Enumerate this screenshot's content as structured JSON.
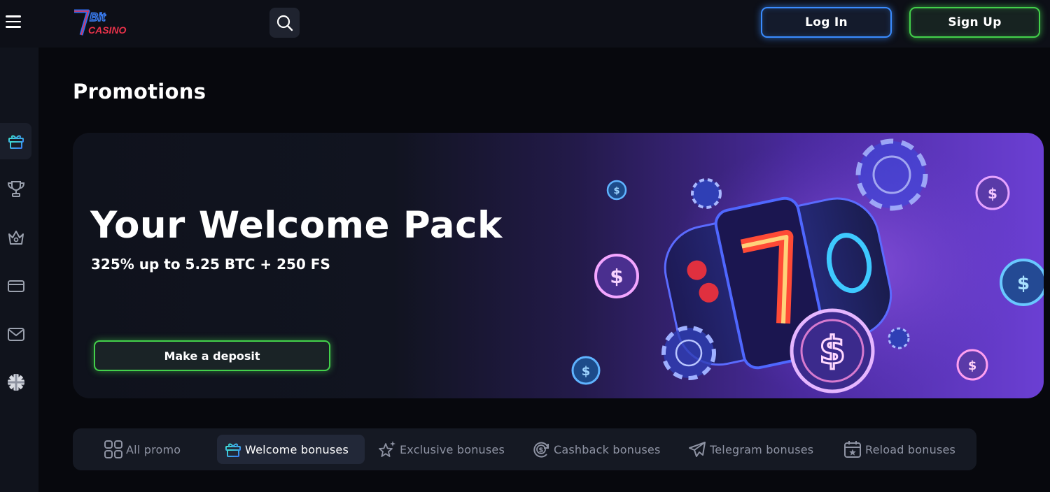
{
  "header": {
    "logo_text": "7Bit CASINO",
    "login_label": "Log In",
    "signup_label": "Sign Up"
  },
  "sidebar": {
    "items": [
      {
        "icon": "gift-icon",
        "active": true
      },
      {
        "icon": "trophy-icon",
        "active": false
      },
      {
        "icon": "crown-icon",
        "active": false
      },
      {
        "icon": "card-icon",
        "active": false
      },
      {
        "icon": "mail-icon",
        "active": false
      },
      {
        "icon": "uk-flag-icon",
        "active": false
      }
    ]
  },
  "main": {
    "page_title": "Promotions",
    "banner": {
      "title": "Your Welcome Pack",
      "subtitle": "325% up to 5.25 BTC + 250 FS",
      "cta_label": "Make a deposit"
    },
    "tabs": [
      {
        "label": "All promo",
        "icon": "grid-icon",
        "active": false
      },
      {
        "label": "Welcome bonuses",
        "icon": "gift-icon",
        "active": true
      },
      {
        "label": "Exclusive bonuses",
        "icon": "star-icon",
        "active": false
      },
      {
        "label": "Cashback bonuses",
        "icon": "cashback-icon",
        "active": false
      },
      {
        "label": "Telegram bonuses",
        "icon": "telegram-icon",
        "active": false
      },
      {
        "label": "Reload bonuses",
        "icon": "calendar-star-icon",
        "active": false
      }
    ]
  },
  "colors": {
    "login_border": "#3a8cff",
    "signup_border": "#43d14b",
    "banner_purple": "#6b3fd3",
    "background": "#07080d"
  }
}
